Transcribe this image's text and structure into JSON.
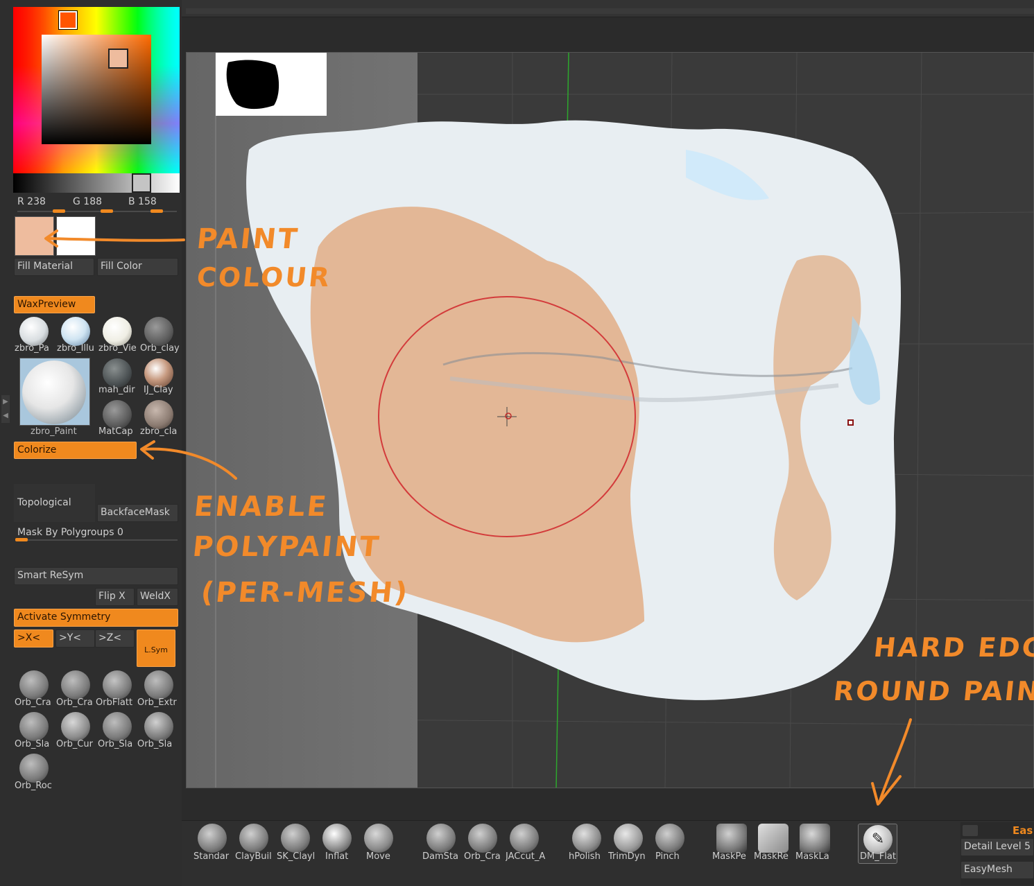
{
  "color_panel": {
    "r_label": "R 238",
    "g_label": "G 188",
    "b_label": "B 158",
    "main_color": "#eebc9e",
    "secondary_color": "#ffffff",
    "fill_material_label": "Fill Material",
    "fill_color_label": "Fill Color"
  },
  "material_panel": {
    "preview_label": "WaxPreview",
    "materials": [
      {
        "label": "zbro_Pa",
        "icon": "material-sphere-white"
      },
      {
        "label": "zbro_Illu",
        "icon": "material-sphere-blue"
      },
      {
        "label": "zbro_Vie",
        "icon": "material-sphere-cream"
      },
      {
        "label": "Orb_clay",
        "icon": "material-sphere-gray"
      },
      {
        "label": "mah_dir",
        "icon": "material-sphere-dark"
      },
      {
        "label": "IJ_Clay",
        "icon": "material-sphere-skin"
      },
      {
        "label": "MatCap",
        "icon": "material-sphere-gray"
      },
      {
        "label": "zbro_cla",
        "icon": "material-sphere-brown"
      }
    ],
    "big_preview_label": "zbro_Paint",
    "colorize_label": "Colorize"
  },
  "masking": {
    "topological_label": "Topological",
    "backface_label": "BackfaceMask",
    "mask_by_polygroups_label": "Mask By Polygroups 0"
  },
  "symmetry": {
    "smart_resym_label": "Smart ReSym",
    "flip_x_label": "Flip X",
    "weld_x_label": "WeldX",
    "activate_label": "Activate Symmetry",
    "axes": [
      ">X<",
      ">Y<",
      ">Z<"
    ],
    "lsym_label": "L.Sym"
  },
  "brush_panel": {
    "brushes": [
      "Orb_Cra",
      "Orb_Cra",
      "OrbFlatt",
      "Orb_Extr",
      "Orb_Sla",
      "Orb_Cur",
      "Orb_Sla",
      "Orb_Sla",
      "Orb_Roc"
    ]
  },
  "bottom_shelf": {
    "group1": [
      "Standar",
      "ClayBuil",
      "SK_Clayl",
      "Inflat",
      "Move"
    ],
    "group2": [
      "DamSta",
      "Orb_Cra",
      "JACcut_A"
    ],
    "group3": [
      "hPolish",
      "TrimDyn",
      "Pinch"
    ],
    "group4": [
      "MaskPe",
      "MaskRe",
      "MaskLa"
    ],
    "active_brush": "DM_Flat",
    "detail_level_label": "Detail Level 5",
    "easymesh_label": "EasyMesh",
    "eas_label": "Eas"
  },
  "annotations": {
    "paint_line1": "PAINT",
    "paint_line2": "COLOUR",
    "enable_line1": "ENABLE",
    "enable_line2": "POLYPAINT",
    "enable_line3": "(PER-MESH)",
    "hard_line1": "HARD EDGE",
    "hard_line2": "ROUND PAINT",
    "color": "#f28a2a"
  }
}
